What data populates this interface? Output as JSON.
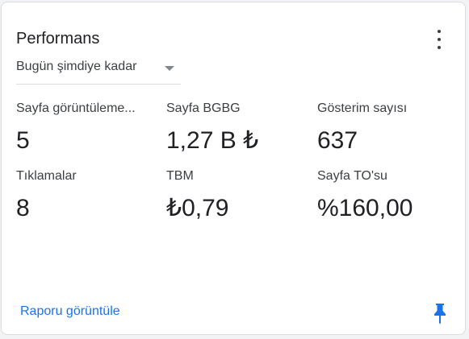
{
  "card": {
    "title": "Performans",
    "more_icon": "more-vert-icon",
    "period": {
      "selected": "Bugün şimdiye kadar",
      "icon": "dropdown-arrow-icon"
    },
    "metrics": [
      {
        "label": "Sayfa görüntüleme...",
        "value": "5"
      },
      {
        "label": "Sayfa BGBG",
        "value": "1,27 B ₺"
      },
      {
        "label": "Gösterim sayısı",
        "value": "637"
      },
      {
        "label": "Tıklamalar",
        "value": "8"
      },
      {
        "label": "TBM",
        "value": "₺0,79"
      },
      {
        "label": "Sayfa TO'su",
        "value": "%160,00"
      }
    ],
    "report_link": "Raporu görüntüle",
    "pin_icon": "pin-icon",
    "colors": {
      "accent": "#1a73e8",
      "text": "#202124",
      "border": "#dadce0"
    }
  }
}
